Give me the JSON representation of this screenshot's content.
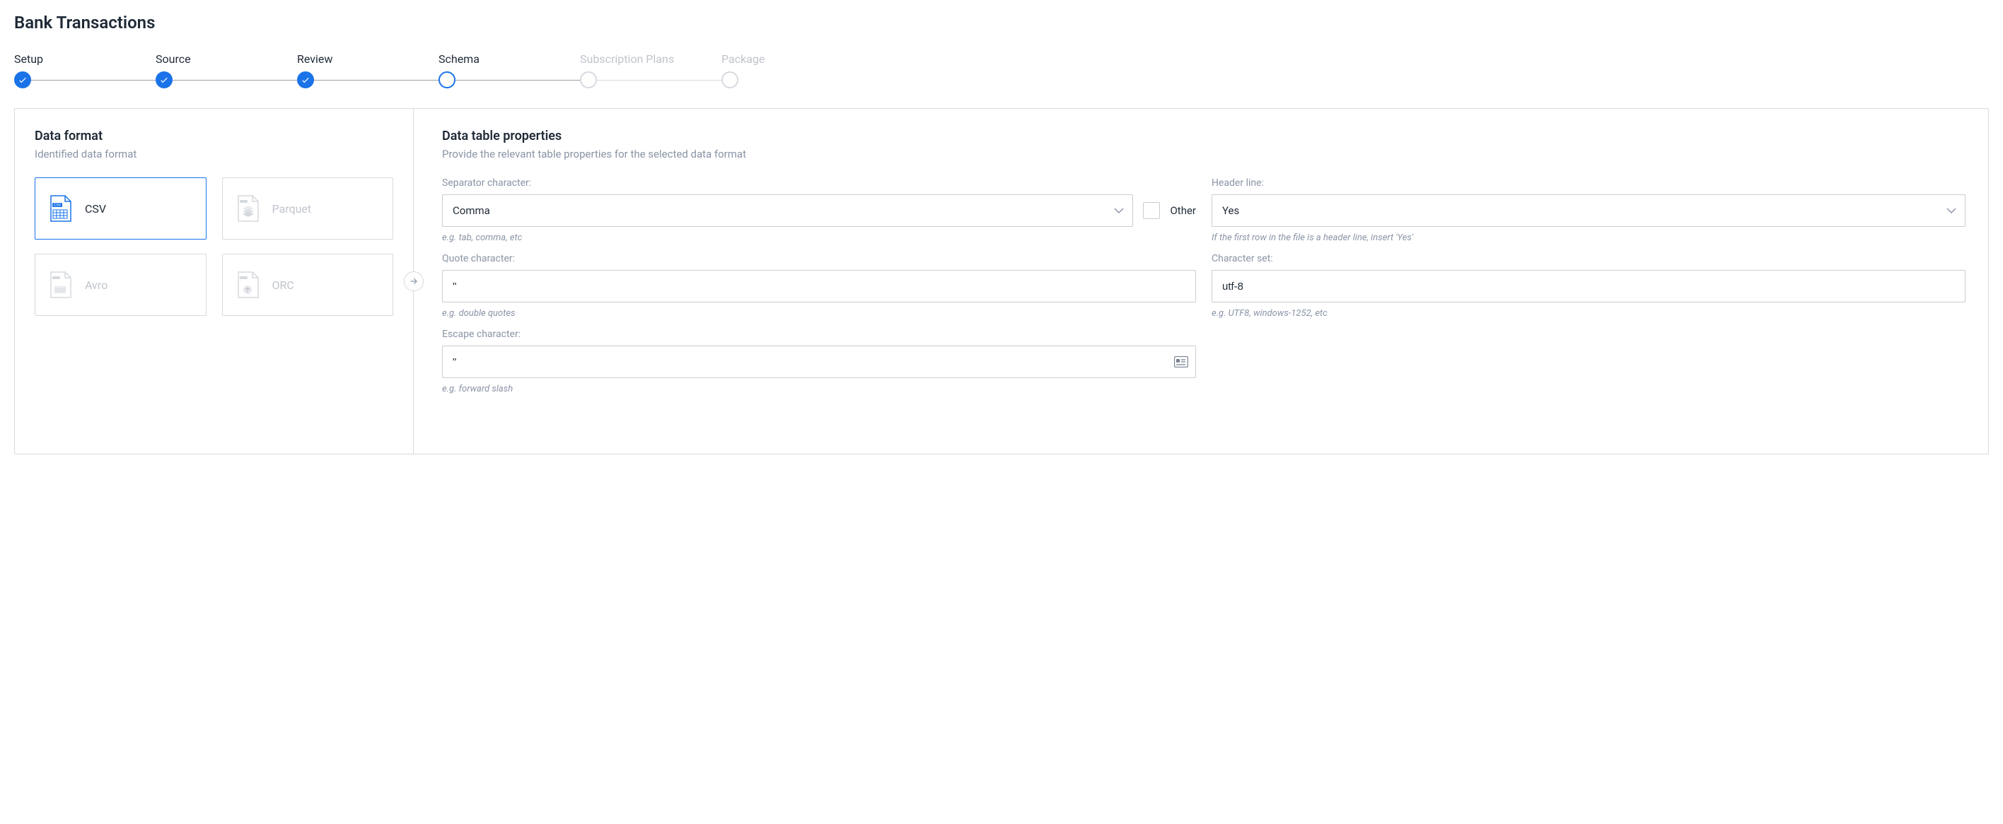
{
  "page_title": "Bank Transactions",
  "stepper": {
    "steps": [
      {
        "label": "Setup",
        "state": "done"
      },
      {
        "label": "Source",
        "state": "done"
      },
      {
        "label": "Review",
        "state": "done"
      },
      {
        "label": "Schema",
        "state": "current"
      },
      {
        "label": "Subscription Plans",
        "state": "pending"
      },
      {
        "label": "Package",
        "state": "pending"
      }
    ]
  },
  "left_panel": {
    "heading": "Data format",
    "subheading": "Identified data format",
    "formats": [
      {
        "label": "CSV",
        "selected": true,
        "icon": "csv-file-icon"
      },
      {
        "label": "Parquet",
        "selected": false,
        "icon": "parquet-file-icon"
      },
      {
        "label": "Avro",
        "selected": false,
        "icon": "avro-file-icon"
      },
      {
        "label": "ORC",
        "selected": false,
        "icon": "orc-file-icon"
      }
    ]
  },
  "right_panel": {
    "heading": "Data table properties",
    "subheading": "Provide the relevant table properties for the selected data format",
    "separator": {
      "label": "Separator character:",
      "value": "Comma",
      "hint": "e.g. tab, comma, etc",
      "other_label": "Other",
      "other_checked": false
    },
    "header_line": {
      "label": "Header line:",
      "value": "Yes",
      "hint": "If the first row in the file is a header line, insert 'Yes'"
    },
    "quote": {
      "label": "Quote character:",
      "value": "\"",
      "hint": "e.g. double quotes"
    },
    "charset": {
      "label": "Character set:",
      "value": "utf-8",
      "hint": "e.g. UTF8, windows-1252, etc"
    },
    "escape": {
      "label": "Escape character:",
      "value": "\"",
      "hint": "e.g. forward slash"
    }
  }
}
